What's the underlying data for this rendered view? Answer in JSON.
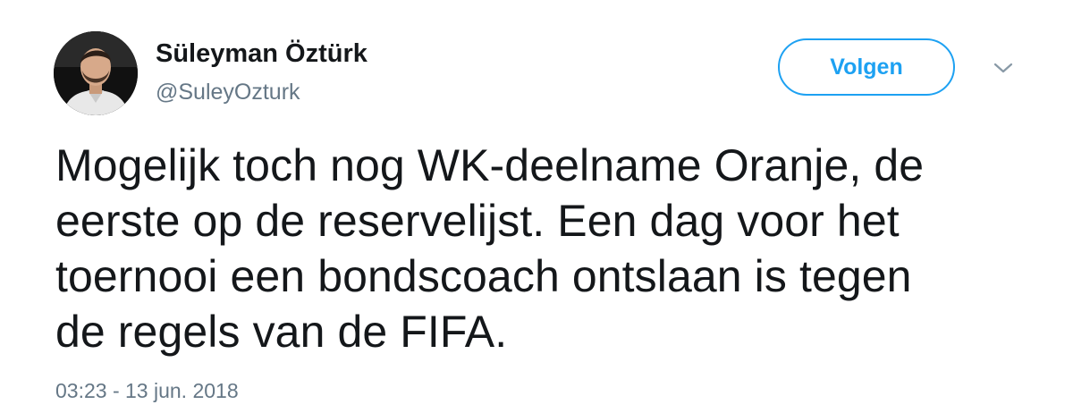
{
  "tweet": {
    "author": {
      "display_name": "Süleyman Öztürk",
      "handle": "@SuleyOzturk",
      "avatar_icon": "profile-photo-icon"
    },
    "follow_button": {
      "label": "Volgen"
    },
    "menu_icon": "chevron-down-icon",
    "text_lines": [
      "Mogelijk toch nog WK-deelname Oranje, de",
      "eerste op de reservelijst. Een dag voor het",
      "toernooi een bondscoach ontslaan is tegen",
      "de regels van de FIFA."
    ],
    "timestamp": "03:23 - 13 jun. 2018"
  },
  "colors": {
    "accent": "#1da1f2",
    "text_primary": "#14171a",
    "text_secondary": "#657786"
  }
}
